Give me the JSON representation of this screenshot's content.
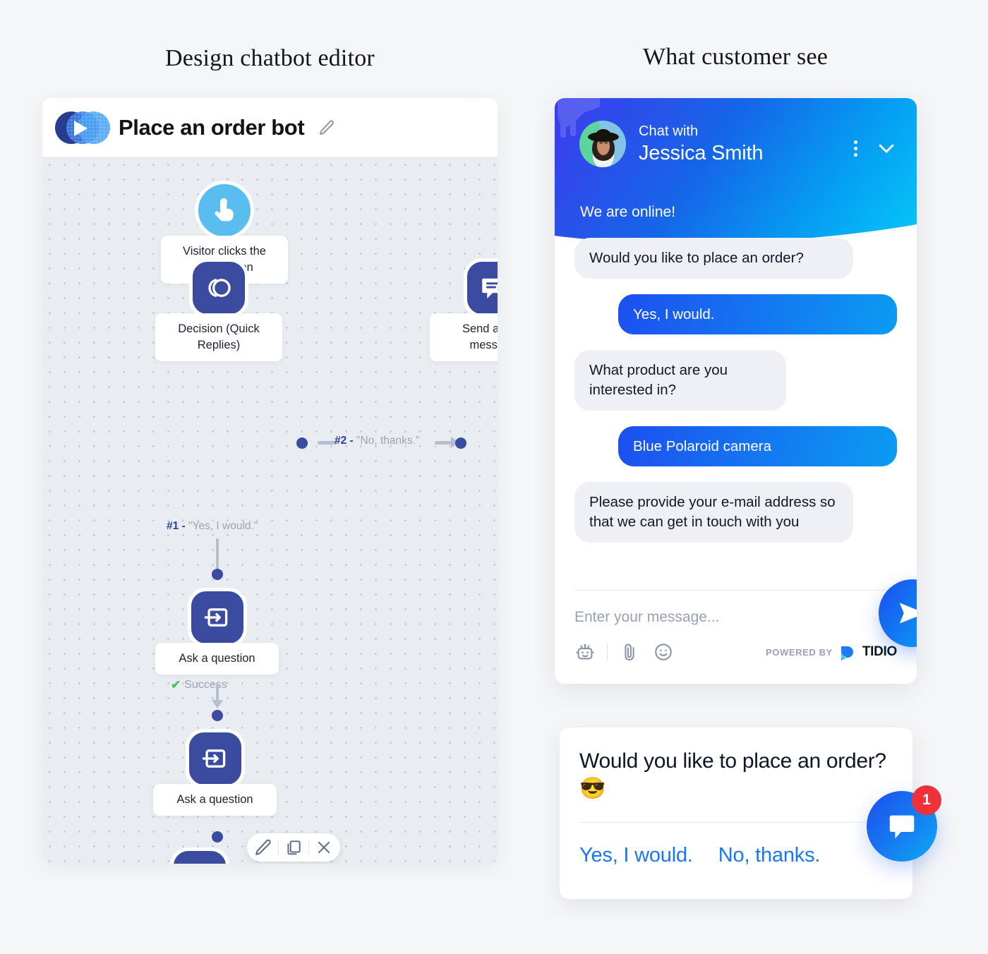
{
  "titles": {
    "left": "Design chatbot editor",
    "right": "What customer see"
  },
  "editor": {
    "bot_name": "Place an order bot",
    "edit_icon": "pencil-icon",
    "logo_icon": "tidio-bot-logo",
    "nodes": [
      {
        "id": "trigger",
        "icon": "tap-hand-icon",
        "label": "Visitor clicks the\nbots button"
      },
      {
        "id": "decision",
        "icon": "quick-replies-icon",
        "label": "Decision (Quick\nReplies)"
      },
      {
        "id": "message",
        "icon": "chat-message-icon",
        "label": "Send a chat\nmessage"
      },
      {
        "id": "ask1",
        "icon": "input-arrow-icon",
        "label": "Ask a question"
      },
      {
        "id": "ask2",
        "icon": "input-arrow-icon",
        "label": "Ask a question"
      },
      {
        "id": "message2",
        "icon": "chat-message-icon",
        "label": ""
      }
    ],
    "edges": [
      {
        "id": "branch2",
        "num": "#2 -",
        "text": "\"No, thanks.\""
      },
      {
        "id": "branch1",
        "num": "#1 -",
        "text": "\"Yes, I would.\""
      }
    ],
    "success_label": "Success",
    "success_tick": "✔",
    "toolbar": {
      "edit": "pencil-icon",
      "duplicate": "copy-icon",
      "delete": "close-icon"
    }
  },
  "chat": {
    "header": {
      "prefix": "Chat with",
      "agent_name": "Jessica Smith",
      "status": "We are online!",
      "menu_icon": "kebab-menu-icon",
      "minimize_icon": "chevron-down-icon",
      "avatar": "agent-avatar"
    },
    "messages": [
      {
        "from": "agent",
        "text": "Would you like to place an order?"
      },
      {
        "from": "user",
        "text": "Yes, I would."
      },
      {
        "from": "agent",
        "text": "What product are you interested in?"
      },
      {
        "from": "user",
        "text": "Blue Polaroid camera"
      },
      {
        "from": "agent",
        "text": "Please provide your e-mail address so that we can get in touch with you"
      }
    ],
    "composer": {
      "placeholder": "Enter your message...",
      "bot_icon": "robot-icon",
      "attach_icon": "paperclip-icon",
      "emoji_icon": "smiley-icon",
      "powered_by": "POWERED BY",
      "brand": "TIDIO",
      "send_icon": "send-icon"
    }
  },
  "quick_reply_card": {
    "question": "Would you like to place an order? 😎",
    "replies": [
      "Yes, I would.",
      "No, thanks."
    ]
  },
  "launcher": {
    "icon": "chat-bubble-icon",
    "badge_count": "1"
  },
  "colors": {
    "page_bg": "#f5f6f8",
    "canvas_bg": "#e9edf1",
    "node_navy": "#3b4ba0",
    "node_cyan": "#59bdf0",
    "accent_blue": "#1877f2",
    "badge_red": "#f0313a",
    "bubble_gray": "#eef0f5"
  }
}
